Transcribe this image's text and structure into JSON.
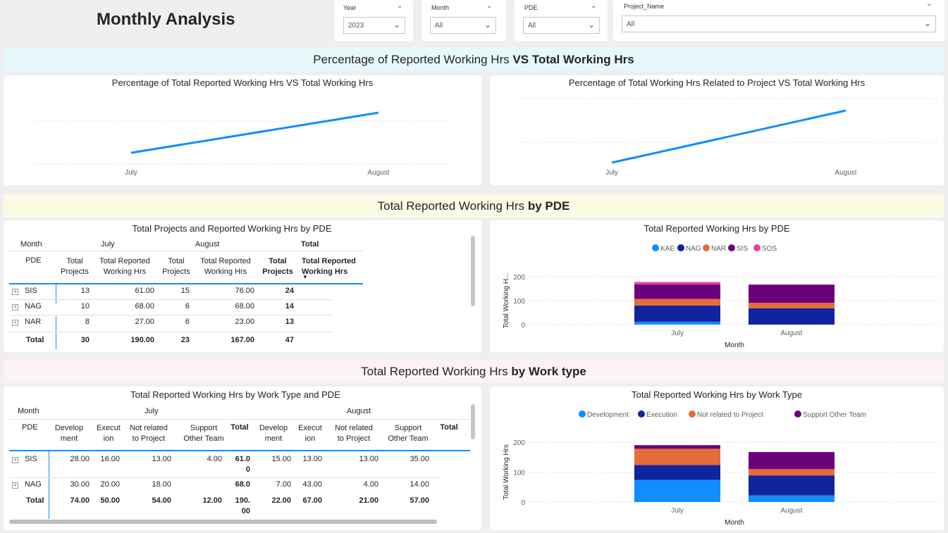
{
  "page": {
    "title": "Monthly Analysis"
  },
  "filters": {
    "year": {
      "label": "Year",
      "value": "2023"
    },
    "month": {
      "label": "Month",
      "value": "All"
    },
    "pde": {
      "label": "PDE",
      "value": "All"
    },
    "project": {
      "label": "Project_Name",
      "value": "All"
    }
  },
  "sections": {
    "s1": {
      "normal": "Percentage of Reported Working Hrs ",
      "bold": "VS Total Working Hrs"
    },
    "s2": {
      "normal": "Total Reported Working Hrs ",
      "bold": "by PDE"
    },
    "s3": {
      "normal": "Total Reported Working Hrs ",
      "bold": "by Work type"
    }
  },
  "line1": {
    "title": "Percentage of Total Reported Working Hrs VS Total Working Hrs",
    "x": [
      "July",
      "August"
    ]
  },
  "line2": {
    "title": "Percentage of Total Working Hrs Related to Project VS Total Working Hrs",
    "x": [
      "July",
      "August"
    ]
  },
  "chart_data": [
    {
      "type": "line",
      "title": "Percentage of Total Reported Working Hrs VS Total Working Hrs",
      "x": [
        "July",
        "August"
      ],
      "series": [
        {
          "values": [
            0.2,
            0.7
          ]
        }
      ]
    },
    {
      "type": "line",
      "title": "Percentage of Total Working Hrs Related to Project VS Total Working Hrs",
      "x": [
        "July",
        "August"
      ],
      "series": [
        {
          "values": [
            0.0,
            0.8
          ]
        }
      ]
    },
    {
      "type": "bar",
      "title": "Total Reported Working Hrs by PDE",
      "xlabel": "Month",
      "ylabel": "Total Working H...",
      "categories": [
        "July",
        "August"
      ],
      "ylim": [
        0,
        200
      ],
      "yticks": [
        0,
        100,
        200
      ],
      "series": [
        {
          "name": "KAE",
          "color": "#118dff",
          "values": [
            12,
            0
          ]
        },
        {
          "name": "NAG",
          "color": "#12239e",
          "values": [
            68,
            68
          ]
        },
        {
          "name": "NAR",
          "color": "#e66c37",
          "values": [
            27,
            23
          ]
        },
        {
          "name": "SIS",
          "color": "#6b007b",
          "values": [
            61,
            76
          ]
        },
        {
          "name": "SOS",
          "color": "#e044a7",
          "values": [
            10,
            0
          ]
        }
      ]
    },
    {
      "type": "bar",
      "title": "Total Reported Working Hrs by Work Type",
      "xlabel": "Month",
      "ylabel": "Total Working Hrs",
      "categories": [
        "July",
        "August"
      ],
      "ylim": [
        0,
        200
      ],
      "yticks": [
        0,
        100,
        200
      ],
      "series": [
        {
          "name": "Development",
          "color": "#118dff",
          "values": [
            74,
            22
          ]
        },
        {
          "name": "Execution",
          "color": "#12239e",
          "values": [
            50,
            67
          ]
        },
        {
          "name": "Not related to Project",
          "color": "#e66c37",
          "values": [
            54,
            21
          ]
        },
        {
          "name": "Support Other Team",
          "color": "#6b007b",
          "values": [
            12,
            57
          ]
        }
      ]
    }
  ],
  "pdeTable": {
    "title": "Total Projects and Reported Working Hrs by PDE",
    "month_label": "Month",
    "pde_label": "PDE",
    "col_july": "July",
    "col_aug": "August",
    "col_total": "Total",
    "h_tp": [
      "Total",
      "Projects"
    ],
    "h_trw": [
      "Total Reported",
      "Working Hrs"
    ],
    "h_ttp": [
      "Total",
      "Projects"
    ],
    "h_ttrw": [
      "Total Reported",
      "Working Hrs"
    ],
    "rows": [
      [
        "SIS",
        "13",
        "61.00",
        "15",
        "76.00",
        "24"
      ],
      [
        "NAG",
        "10",
        "68.00",
        "6",
        "68.00",
        "14"
      ],
      [
        "NAR",
        "8",
        "27.00",
        "6",
        "23.00",
        "13"
      ]
    ],
    "total": [
      "Total",
      "30",
      "190.00",
      "23",
      "167.00",
      "47"
    ]
  },
  "wtTable": {
    "title": "Total Reported Working Hrs by Work Type and PDE",
    "month_label": "Month",
    "pde_label": "PDE",
    "col_july": "July",
    "col_aug": "August",
    "h_dev": [
      "Develop",
      "ment"
    ],
    "h_exe": [
      "Execut",
      "ion"
    ],
    "h_nrp": [
      "Not related",
      "to Project"
    ],
    "h_sot": [
      "Support",
      "Other Team"
    ],
    "h_total": "Total",
    "rows": [
      [
        "SIS",
        "28.00",
        "16.00",
        "13.00",
        "4.00",
        "61.0",
        "0",
        "15.00",
        "13.00",
        "13.00",
        "35.00"
      ],
      [
        "NAG",
        "30.00",
        "20.00",
        "18.00",
        "",
        "68.0",
        "",
        "7.00",
        "43.00",
        "4.00",
        "14.00"
      ]
    ],
    "total": [
      "Total",
      "74.00",
      "50.00",
      "54.00",
      "12.00",
      "190.",
      "00",
      "22.00",
      "67.00",
      "21.00",
      "57.00"
    ]
  }
}
